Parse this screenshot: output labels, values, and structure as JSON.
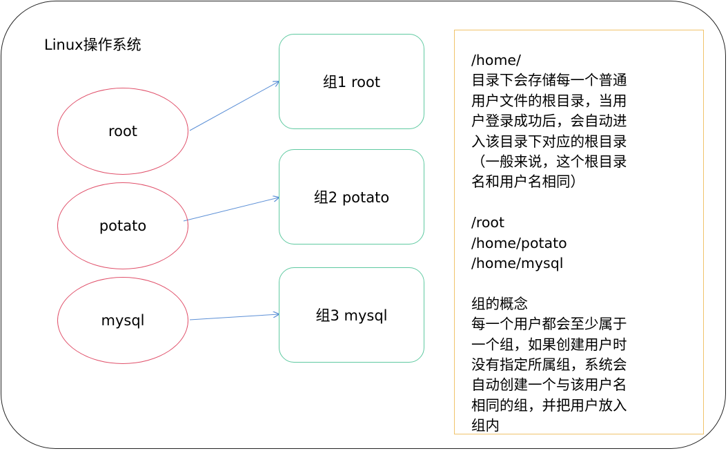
{
  "title": "Linux操作系统",
  "users": [
    "root",
    "potato",
    "mysql"
  ],
  "groups": [
    "组1 root",
    "组2 potato",
    "组3 mysql"
  ],
  "note": {
    "paragraphs": [
      [
        "/home/",
        "目录下会存储每一个普通",
        "用户文件的根目录，当用",
        "户登录成功后，会自动进",
        "入该目录下对应的根目录",
        "（一般来说，这个根目录",
        "名和用户名相同）"
      ],
      [
        "/root",
        "/home/potato",
        "/home/mysql"
      ],
      [
        "组的概念",
        "每一个用户都会至少属于",
        "一个组，如果创建用户时",
        "没有指定所属组，系统会",
        "自动创建一个与该用户名",
        "相同的组，并把用户放入",
        "组内"
      ]
    ]
  },
  "colors": {
    "user_border": "#e0506a",
    "group_border": "#5ec9a0",
    "note_border": "#f0c36a",
    "arrow": "#5b8fd6"
  }
}
